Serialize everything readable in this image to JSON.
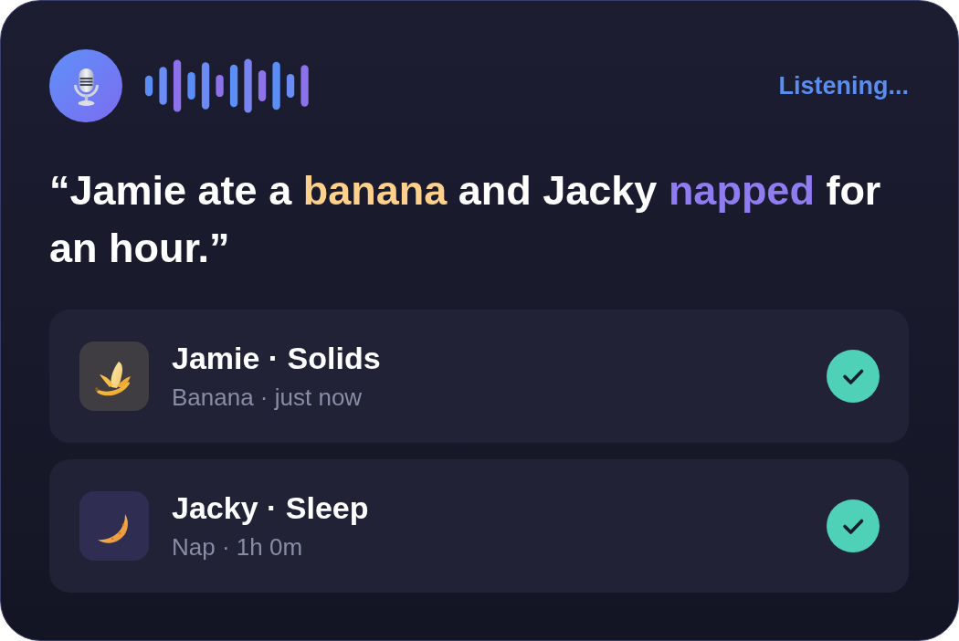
{
  "header": {
    "status": "Listening..."
  },
  "transcript": {
    "segments": [
      {
        "text": "“Jamie ate a "
      },
      {
        "text": "banana",
        "color": "#fdd08b"
      },
      {
        "text": " and Jacky "
      },
      {
        "text": "napped",
        "color": "#8e7cf0"
      },
      {
        "text": " for an hour.”"
      }
    ]
  },
  "entries": [
    {
      "kind": "food",
      "title": "Jamie · Solids",
      "detail": "Banana · just now",
      "checked": true
    },
    {
      "kind": "sleep",
      "title": "Jacky · Sleep",
      "detail": "Nap · 1h 0m",
      "checked": true
    }
  ]
}
